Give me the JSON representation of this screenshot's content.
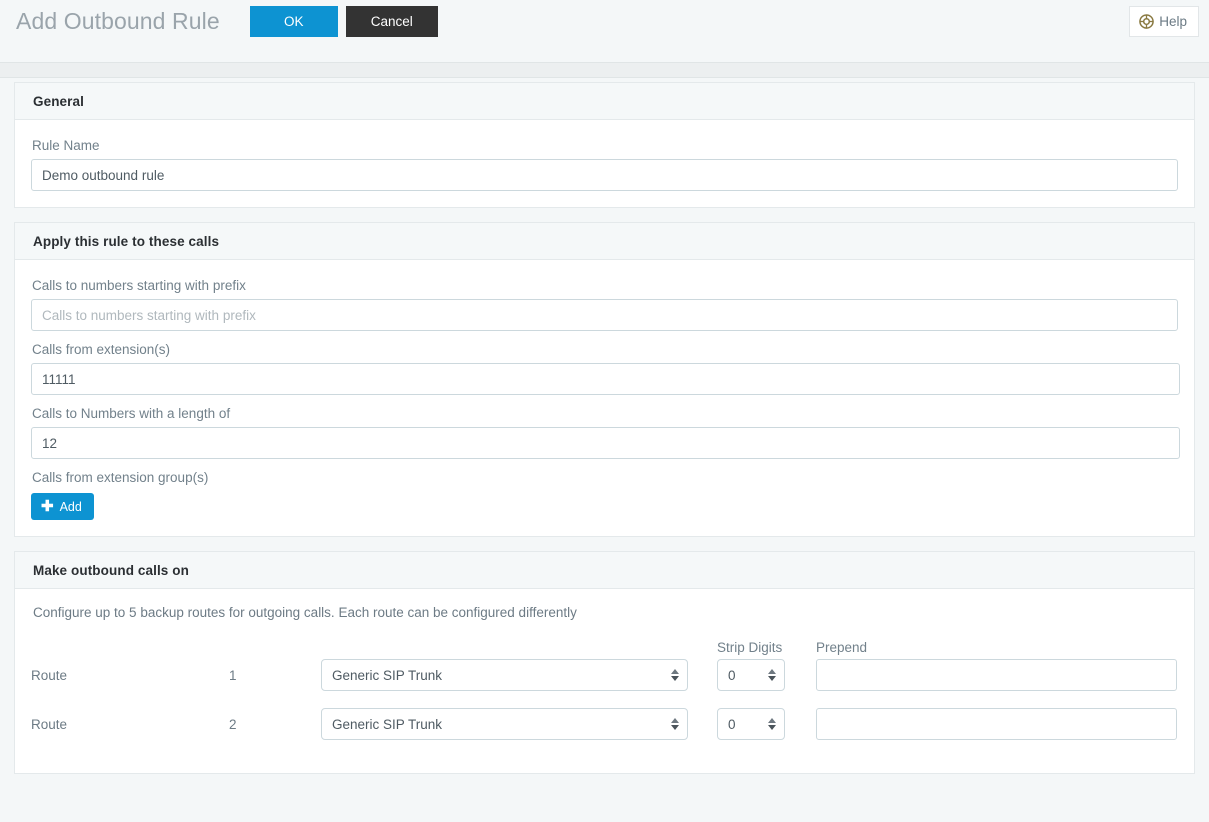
{
  "header": {
    "title": "Add Outbound Rule",
    "ok_label": "OK",
    "cancel_label": "Cancel",
    "help_label": "Help",
    "help_icon": "lifebuoy-icon",
    "accent_color": "#0d93d2",
    "cancel_color": "#333333"
  },
  "general": {
    "section_title": "General",
    "rule_name_label": "Rule Name",
    "rule_name_value": "Demo outbound rule",
    "rule_name_placeholder": "Rule Name"
  },
  "apply_rules": {
    "section_title": "Apply this rule to these calls",
    "prefix_label": "Calls to numbers starting with prefix",
    "prefix_value": "",
    "prefix_placeholder": "Calls to numbers starting with prefix",
    "extensions_label": "Calls from extension(s)",
    "extensions_value": "11111",
    "extensions_placeholder": "Calls from extension(s)",
    "length_label": "Calls to Numbers with a length of",
    "length_value": "12",
    "length_placeholder": "Calls to Numbers with a length of",
    "group_label": "Calls from extension group(s)",
    "add_label": "Add",
    "add_icon": "plus-icon"
  },
  "outbound": {
    "section_title": "Make outbound calls on",
    "description": "Configure up to 5 backup routes for outgoing calls. Each route can be configured differently",
    "columns": {
      "route": "Route",
      "number": "",
      "trunk": "",
      "strip_digits": "Strip Digits",
      "prepend": "Prepend"
    },
    "trunk_options": [
      "Generic SIP Trunk"
    ],
    "routes": [
      {
        "label": "Route",
        "number": "1",
        "trunk": "Generic SIP Trunk",
        "strip_digits": "0",
        "prepend": "",
        "prepend_placeholder": ""
      },
      {
        "label": "Route",
        "number": "2",
        "trunk": "Generic SIP Trunk",
        "strip_digits": "0",
        "prepend": "",
        "prepend_placeholder": ""
      }
    ]
  }
}
